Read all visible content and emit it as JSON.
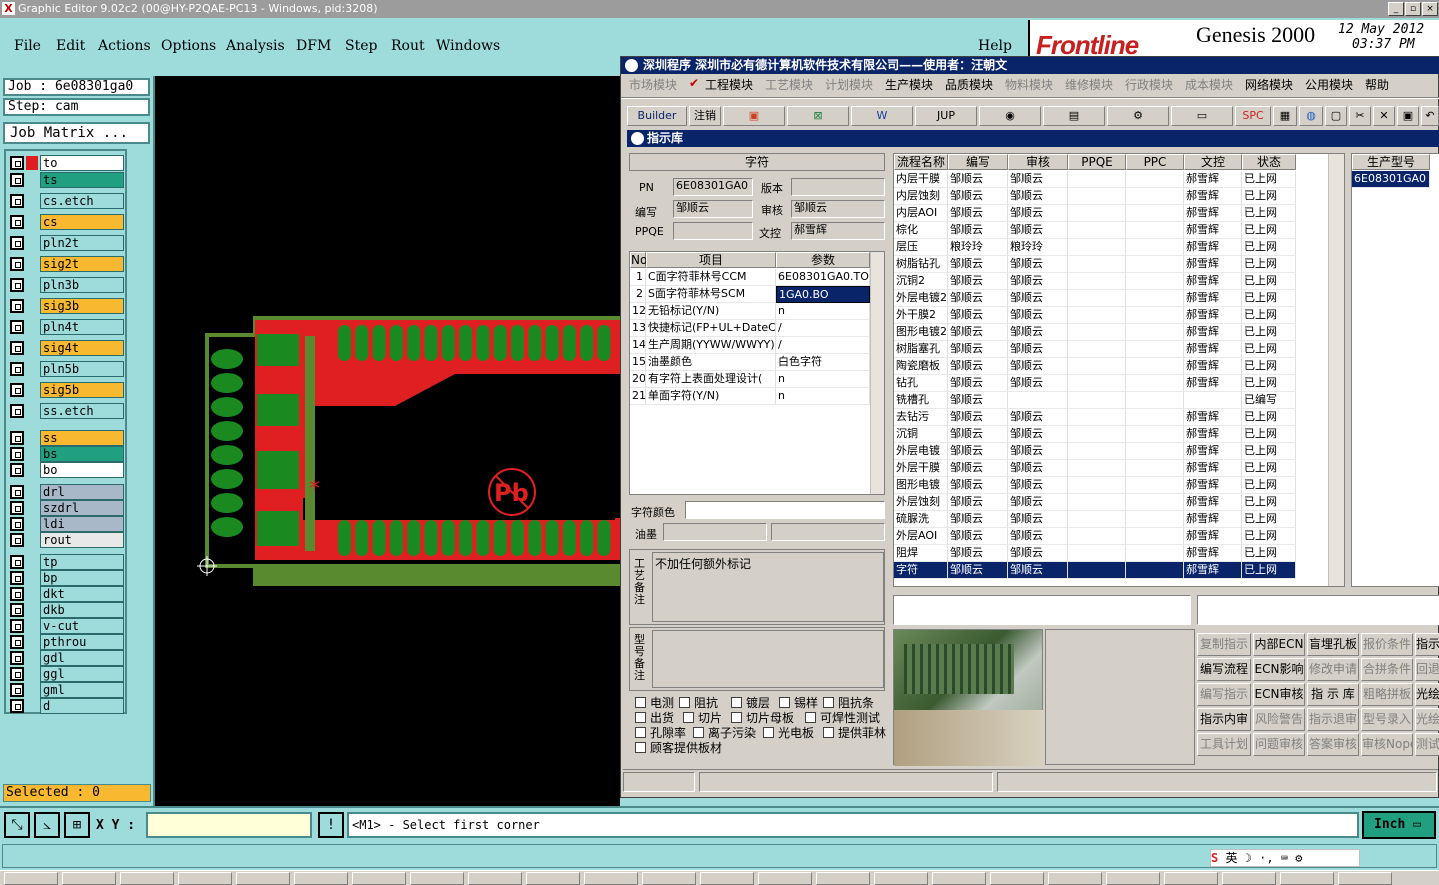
{
  "window": {
    "title": "Graphic Editor 9.02c2 (00@HY-P2QAE-PC13 - Windows, pid:3208)"
  },
  "menu": {
    "items": [
      "File",
      "Edit",
      "Actions",
      "Options",
      "Analysis",
      "DFM",
      "Step",
      "Rout",
      "Windows"
    ],
    "help": "Help"
  },
  "genesis": {
    "brand": "Frontline",
    "product": "Genesis 2000",
    "date": "12 May 2012",
    "time": "03:37 PM"
  },
  "job": {
    "job_label": "Job  :  6e08301ga0",
    "step_label": "Step:  cam",
    "matrix_button": "Job Matrix ..."
  },
  "layers": [
    {
      "name": "to",
      "color": "#ffffff"
    },
    {
      "name": "ts",
      "color": "#20a080"
    },
    {
      "name": "cs.etch",
      "color": "#9edcdc"
    },
    {
      "name": "cs",
      "color": "#f8b830"
    },
    {
      "name": "pln2t",
      "color": "#9edcdc"
    },
    {
      "name": "sig2t",
      "color": "#f8b830"
    },
    {
      "name": "pln3b",
      "color": "#9edcdc"
    },
    {
      "name": "sig3b",
      "color": "#f8b830"
    },
    {
      "name": "pln4t",
      "color": "#9edcdc"
    },
    {
      "name": "sig4t",
      "color": "#f8b830"
    },
    {
      "name": "pln5b",
      "color": "#9edcdc"
    },
    {
      "name": "sig5b",
      "color": "#f8b830"
    },
    {
      "name": "ss.etch",
      "color": "#9edcdc"
    },
    {
      "name": "ss",
      "color": "#f8b830"
    },
    {
      "name": "bs",
      "color": "#20a080"
    },
    {
      "name": "bo",
      "color": "#ffffff"
    },
    {
      "name": "drl",
      "color": "#a8b8c8"
    },
    {
      "name": "szdrl",
      "color": "#a8b8c8"
    },
    {
      "name": "ldi",
      "color": "#a8b8c8"
    },
    {
      "name": "rout",
      "color": "#e8e8e8"
    },
    {
      "name": "tp",
      "color": "#9edcdc"
    },
    {
      "name": "bp",
      "color": "#9edcdc"
    },
    {
      "name": "dkt",
      "color": "#9edcdc"
    },
    {
      "name": "dkb",
      "color": "#9edcdc"
    },
    {
      "name": "v-cut",
      "color": "#9edcdc"
    },
    {
      "name": "pthrou",
      "color": "#9edcdc"
    },
    {
      "name": "gdl",
      "color": "#9edcdc"
    },
    {
      "name": "ggl",
      "color": "#9edcdc"
    },
    {
      "name": "gml",
      "color": "#9edcdc"
    },
    {
      "name": "d",
      "color": "#9edcdc"
    }
  ],
  "status": {
    "selected": "Selected : 0",
    "xy_label": "X Y :",
    "xy_value": "",
    "prompt": "<M1> - Select first corner",
    "units": "Inch"
  },
  "dialog": {
    "title": "深圳程序     深圳市必有德计算机软件技术有限公司——使用者：汪朝文",
    "menu": [
      {
        "label": "市场模块",
        "active": false
      },
      {
        "label": "工程模块",
        "active": true
      },
      {
        "label": "工艺模块",
        "active": false
      },
      {
        "label": "计划模块",
        "active": false
      },
      {
        "label": "生产模块",
        "active": true
      },
      {
        "label": "品质模块",
        "active": true
      },
      {
        "label": "物料模块",
        "active": false
      },
      {
        "label": "维修模块",
        "active": false
      },
      {
        "label": "行政模块",
        "active": false
      },
      {
        "label": "成本模块",
        "active": false
      },
      {
        "label": "网络模块",
        "active": true
      },
      {
        "label": "公用模块",
        "active": true
      },
      {
        "label": "帮助",
        "active": true
      }
    ],
    "toolbar": {
      "builder": "Builder",
      "logout": "注销",
      "jup": "JUP",
      "spc": "SPC"
    },
    "panel_title": "指示库",
    "form": {
      "section": "字符",
      "pn_label": "PN",
      "pn_value": "6E08301GA0",
      "version_label": "版本",
      "version_value": "",
      "author_label": "编写",
      "author_value": "邹顺云",
      "reviewer_label": "审核",
      "reviewer_value": "邹顺云",
      "ppqe_label": "PPQE",
      "ppqe_value": "",
      "docctrl_label": "文控",
      "docctrl_value": "郝雪辉"
    },
    "items_header": {
      "no": "No",
      "item": "项目",
      "param": "参数"
    },
    "items": [
      {
        "no": "1",
        "item": "C面字符菲林号CCM",
        "param": "6E08301GA0.TO"
      },
      {
        "no": "2",
        "item": "S面字符菲林号SCM",
        "param": "1GA0.BO"
      },
      {
        "no": "12",
        "item": "无铅标记(Y/N)",
        "param": "n"
      },
      {
        "no": "13",
        "item": "快捷标记(FP+UL+DateCo",
        "param": "/"
      },
      {
        "no": "14",
        "item": "生产周期(YYWW/WWYY)",
        "param": "/"
      },
      {
        "no": "15",
        "item": "油墨颜色",
        "param": "白色字符"
      },
      {
        "no": "20",
        "item": "有字符上表面处理设计(",
        "param": "n"
      },
      {
        "no": "21",
        "item": "单面字符(Y/N)",
        "param": "n"
      }
    ],
    "char_color_label": "字符颜色",
    "ink_label": "油墨",
    "process_note_label": "工艺备注",
    "process_note_value": "不加任何额外标记",
    "model_note_label": "型号备注",
    "checkboxes": [
      [
        "电测",
        "阻抗",
        "镀层",
        "锡样",
        "阻抗条"
      ],
      [
        "出货",
        "切片",
        "切片母板",
        "可焊性测试"
      ],
      [
        "孔隙率",
        "离子污染",
        "光电板",
        "提供菲林"
      ],
      [
        "顾客提供板材"
      ]
    ],
    "flow_header": [
      "流程名称",
      "编写",
      "审核",
      "PPQE",
      "PPC",
      "文控",
      "状态"
    ],
    "flow_rows": [
      [
        "内层干膜",
        "邹顺云",
        "邹顺云",
        "",
        "",
        "郝雪辉",
        "已上网"
      ],
      [
        "内层蚀刻",
        "邹顺云",
        "邹顺云",
        "",
        "",
        "郝雪辉",
        "已上网"
      ],
      [
        "内层AOI",
        "邹顺云",
        "邹顺云",
        "",
        "",
        "郝雪辉",
        "已上网"
      ],
      [
        "棕化",
        "邹顺云",
        "邹顺云",
        "",
        "",
        "郝雪辉",
        "已上网"
      ],
      [
        "层压",
        "粮玲玲",
        "粮玲玲",
        "",
        "",
        "郝雪辉",
        "已上网"
      ],
      [
        "树脂钻孔",
        "邹顺云",
        "邹顺云",
        "",
        "",
        "郝雪辉",
        "已上网"
      ],
      [
        "沉铜2",
        "邹顺云",
        "邹顺云",
        "",
        "",
        "郝雪辉",
        "已上网"
      ],
      [
        "外层电镀2",
        "邹顺云",
        "邹顺云",
        "",
        "",
        "郝雪辉",
        "已上网"
      ],
      [
        "外干膜2",
        "邹顺云",
        "邹顺云",
        "",
        "",
        "郝雪辉",
        "已上网"
      ],
      [
        "图形电镀2",
        "邹顺云",
        "邹顺云",
        "",
        "",
        "郝雪辉",
        "已上网"
      ],
      [
        "树脂塞孔",
        "邹顺云",
        "邹顺云",
        "",
        "",
        "郝雪辉",
        "已上网"
      ],
      [
        "陶瓷磨板",
        "邹顺云",
        "邹顺云",
        "",
        "",
        "郝雪辉",
        "已上网"
      ],
      [
        "钻孔",
        "邹顺云",
        "邹顺云",
        "",
        "",
        "郝雪辉",
        "已上网"
      ],
      [
        "铣槽孔",
        "邹顺云",
        "",
        "",
        "",
        "",
        "已编写"
      ],
      [
        "去钻污",
        "邹顺云",
        "邹顺云",
        "",
        "",
        "郝雪辉",
        "已上网"
      ],
      [
        "沉铜",
        "邹顺云",
        "邹顺云",
        "",
        "",
        "郝雪辉",
        "已上网"
      ],
      [
        "外层电镀",
        "邹顺云",
        "邹顺云",
        "",
        "",
        "郝雪辉",
        "已上网"
      ],
      [
        "外层干膜",
        "邹顺云",
        "邹顺云",
        "",
        "",
        "郝雪辉",
        "已上网"
      ],
      [
        "图形电镀",
        "邹顺云",
        "邹顺云",
        "",
        "",
        "郝雪辉",
        "已上网"
      ],
      [
        "外层蚀刻",
        "邹顺云",
        "邹顺云",
        "",
        "",
        "郝雪辉",
        "已上网"
      ],
      [
        "硫脲洗",
        "邹顺云",
        "邹顺云",
        "",
        "",
        "郝雪辉",
        "已上网"
      ],
      [
        "外层AOI",
        "邹顺云",
        "邹顺云",
        "",
        "",
        "郝雪辉",
        "已上网"
      ],
      [
        "阻焊",
        "邹顺云",
        "邹顺云",
        "",
        "",
        "郝雪辉",
        "已上网"
      ],
      [
        "字符",
        "邹顺云",
        "邹顺云",
        "",
        "",
        "郝雪辉",
        "已上网"
      ]
    ],
    "model_header": "生产型号",
    "model_value": "6E08301GA0",
    "side_buttons": [
      [
        {
          "label": "复制指示",
          "dis": true
        },
        {
          "label": "内部ECN",
          "dis": false
        },
        {
          "label": "盲埋孔板",
          "dis": false
        },
        {
          "label": "报价条件",
          "dis": true
        },
        {
          "label": "指示",
          "dis": false
        }
      ],
      [
        {
          "label": "编写流程",
          "dis": false
        },
        {
          "label": "ECN影响",
          "dis": false
        },
        {
          "label": "修改申请",
          "dis": true
        },
        {
          "label": "合拼条件",
          "dis": true
        },
        {
          "label": "回退",
          "dis": true
        }
      ],
      [
        {
          "label": "编写指示",
          "dis": true
        },
        {
          "label": "ECN审核",
          "dis": false
        },
        {
          "label": "指 示 库",
          "dis": false
        },
        {
          "label": "粗略拼板",
          "dis": true
        },
        {
          "label": "光绘",
          "dis": false
        }
      ],
      [
        {
          "label": "指示内审",
          "dis": false
        },
        {
          "label": "风险警告",
          "dis": true
        },
        {
          "label": "指示退审",
          "dis": true
        },
        {
          "label": "型号录入",
          "dis": true
        },
        {
          "label": "光绘",
          "dis": true
        }
      ],
      [
        {
          "label": "工具计划",
          "dis": true
        },
        {
          "label": "问题审核",
          "dis": true
        },
        {
          "label": "答案审核",
          "dis": true
        },
        {
          "label": "审核Nope",
          "dis": true
        },
        {
          "label": "测试",
          "dis": true
        }
      ]
    ]
  },
  "ime": {
    "label": "英"
  }
}
